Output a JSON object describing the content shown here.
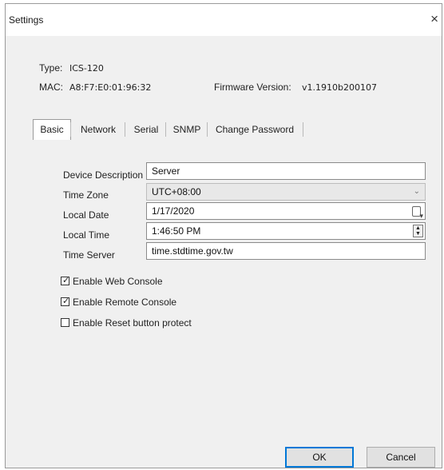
{
  "window": {
    "title": "Settings",
    "close_glyph": "×"
  },
  "device_info": {
    "type_label": "Type:",
    "type_value": "ICS-120",
    "mac_label": "MAC:",
    "mac_value": "A8:F7:E0:01:96:32",
    "firmware_label": "Firmware Version:",
    "firmware_value": "v1.1910b200107"
  },
  "tabs": [
    {
      "label": "Basic",
      "active": true
    },
    {
      "label": "Network",
      "active": false
    },
    {
      "label": "Serial",
      "active": false
    },
    {
      "label": "SNMP",
      "active": false
    },
    {
      "label": "Change Password",
      "active": false
    }
  ],
  "form": {
    "device_description_label": "Device Description",
    "device_description_value": "Server",
    "time_zone_label": "Time Zone",
    "time_zone_value": "UTC+08:00",
    "local_date_label": "Local Date",
    "local_date_value": "1/17/2020",
    "local_time_label": "Local Time",
    "local_time_value": "1:46:50 PM",
    "time_server_label": "Time Server",
    "time_server_value": "time.stdtime.gov.tw"
  },
  "checkboxes": [
    {
      "label": "Enable Web Console",
      "checked": true
    },
    {
      "label": "Enable Remote Console",
      "checked": true
    },
    {
      "label": "Enable Reset button protect",
      "checked": false
    }
  ],
  "buttons": {
    "ok_label": "OK",
    "cancel_label": "Cancel"
  },
  "icons": {
    "close": "close-icon",
    "combo_arrow": "chevron-down-icon",
    "calendar": "calendar-icon",
    "spinner": "spinner-icon",
    "checkmark": "checkmark-icon"
  },
  "colors": {
    "dialog_bg": "#f0f0f0",
    "field_bg": "#ffffff",
    "default_button_border": "#0078d7"
  }
}
